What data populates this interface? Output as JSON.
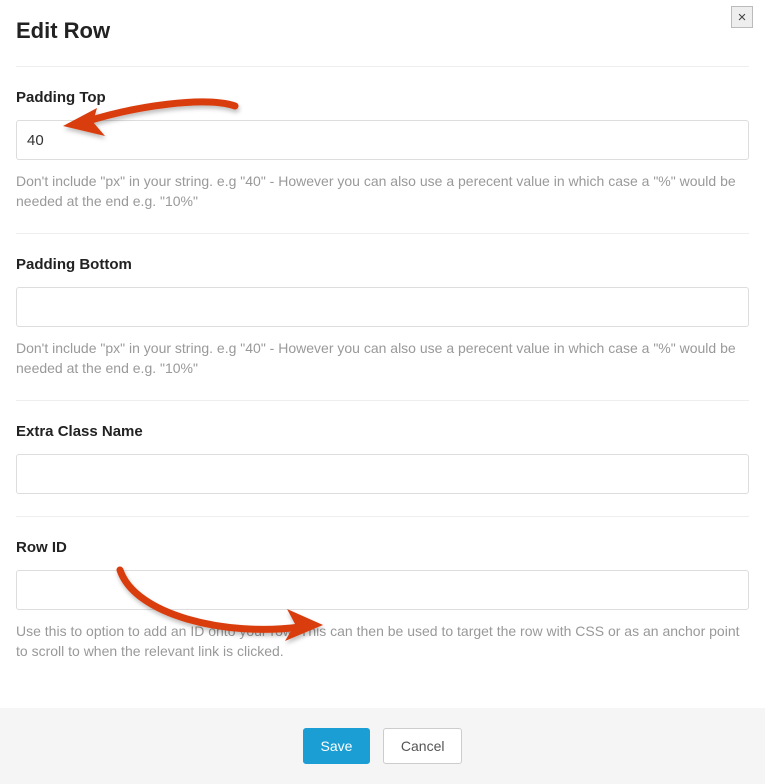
{
  "header": {
    "title": "Edit Row",
    "close": "×"
  },
  "fields": {
    "padding_top": {
      "label": "Padding Top",
      "value": "40",
      "help": "Don't include \"px\" in your string. e.g \"40\" - However you can also use a perecent value in which case a \"%\" would be needed at the end e.g. \"10%\""
    },
    "padding_bottom": {
      "label": "Padding Bottom",
      "value": "",
      "help": "Don't include \"px\" in your string. e.g \"40\" - However you can also use a perecent value in which case a \"%\" would be needed at the end e.g. \"10%\""
    },
    "extra_class": {
      "label": "Extra Class Name",
      "value": ""
    },
    "row_id": {
      "label": "Row ID",
      "value": "",
      "help": "Use this to option to add an ID onto your row. This can then be used to target the row with CSS or as an anchor point to scroll to when the relevant link is clicked."
    }
  },
  "footer": {
    "save": "Save",
    "cancel": "Cancel"
  },
  "arrow_color": "#d93e11"
}
